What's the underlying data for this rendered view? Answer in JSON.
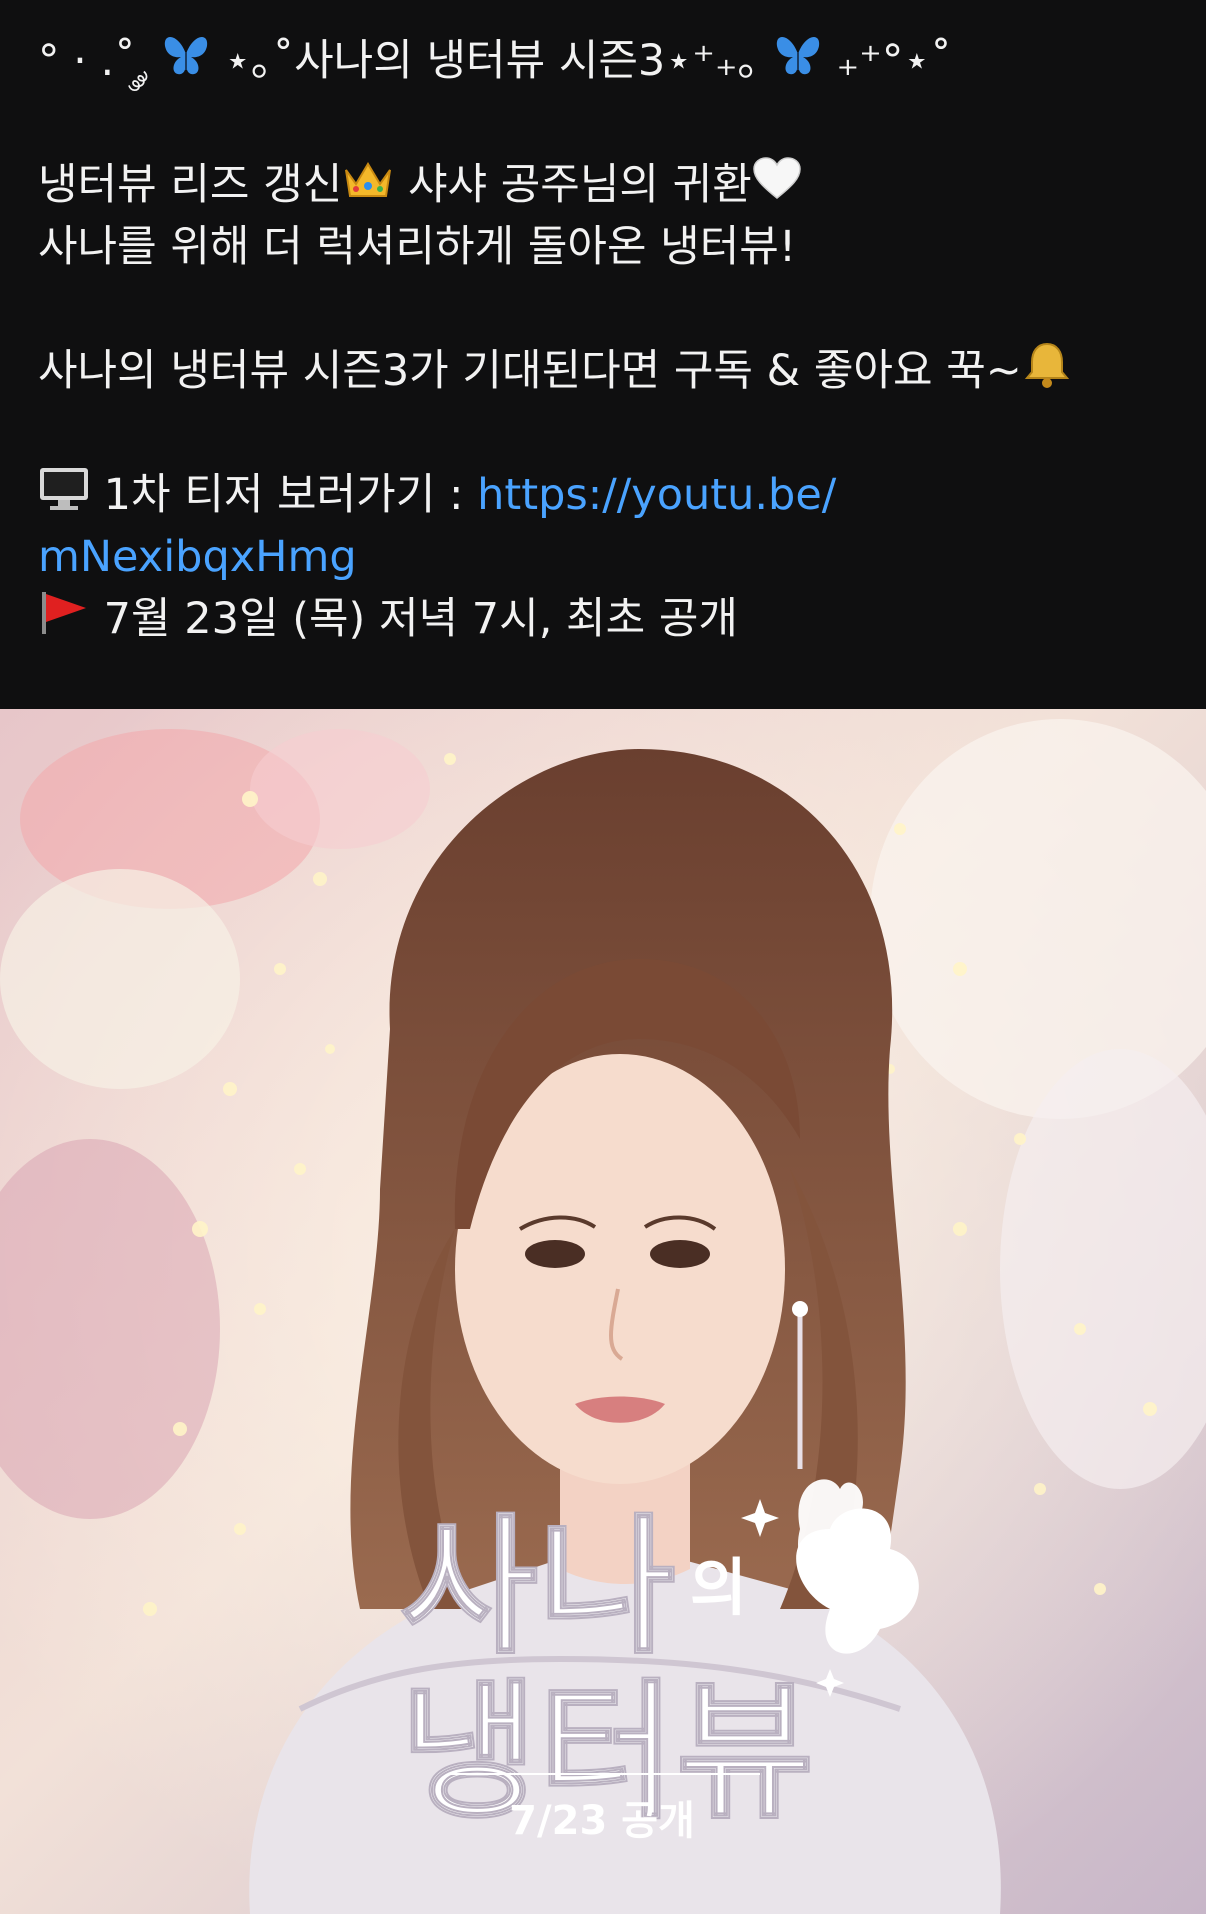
{
  "post": {
    "line1_pre": "° · .˚ ༘",
    "line1_mid": "⋆｡˚사나의 냉터뷰 시즌3⋆⁺₊｡",
    "line1_post": "₊⁺°⋆˚",
    "line2_a": "냉터뷰 리즈 갱신",
    "line2_b": "샤샤 공주님의 귀환",
    "line3": "사나를 위해 더 럭셔리하게 돌아온 냉터뷰!",
    "line4": "사나의 냉터뷰 시즌3가 기대된다면 구독 & 좋아요 꾹~",
    "teaser_label": "1차 티저 보러가기 :",
    "teaser_link_part1": "https://youtu.be/",
    "teaser_link_part2": "mNexibqxHmg",
    "release_text": "7월 23일 (목) 저녁 7시, 최초 공개"
  },
  "poster": {
    "title_line1": "사나",
    "title_particle": "의",
    "title_line2": "냉터뷰",
    "release": "7/23 공개"
  },
  "icons": [
    "butterfly-icon",
    "crown-icon",
    "white-heart-icon",
    "bell-icon",
    "computer-icon",
    "red-flag-icon"
  ],
  "colors": {
    "background": "#0f0f10",
    "text": "#f2f2f2",
    "link": "#4aa3ff"
  }
}
